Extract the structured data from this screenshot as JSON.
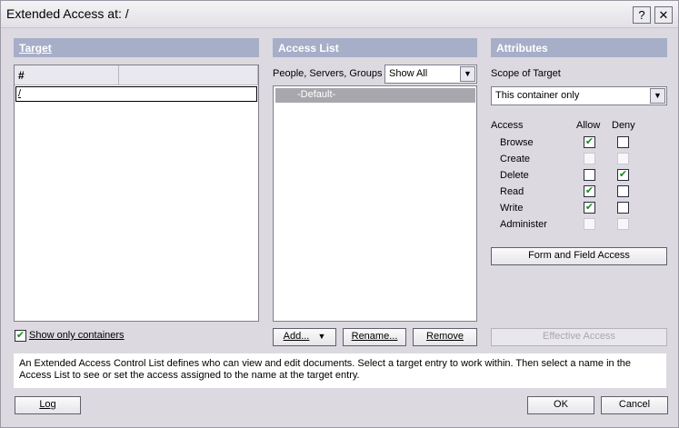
{
  "window": {
    "title": "Extended Access at: /",
    "help_glyph": "?",
    "close_glyph": "✕"
  },
  "target": {
    "header": "Target",
    "column_hash": "#",
    "rows": [
      "/"
    ],
    "show_only_containers_label": "Show only containers",
    "show_only_containers_checked": true
  },
  "access_list": {
    "header": "Access List",
    "filter_label": "People, Servers, Groups",
    "filter_value": "Show All",
    "entries": [
      "-Default-"
    ],
    "add_label": "Add...",
    "rename_label": "Rename...",
    "remove_label": "Remove"
  },
  "attributes": {
    "header": "Attributes",
    "scope_label": "Scope of Target",
    "scope_value": "This container only",
    "access_col": "Access",
    "allow_col": "Allow",
    "deny_col": "Deny",
    "rows": [
      {
        "label": "Browse",
        "allow": "checked",
        "deny": "unchecked"
      },
      {
        "label": "Create",
        "allow": "disabled",
        "deny": "disabled"
      },
      {
        "label": "Delete",
        "allow": "unchecked",
        "deny": "checked"
      },
      {
        "label": "Read",
        "allow": "checked",
        "deny": "unchecked"
      },
      {
        "label": "Write",
        "allow": "checked",
        "deny": "unchecked"
      },
      {
        "label": "Administer",
        "allow": "disabled",
        "deny": "disabled"
      }
    ],
    "form_field_label": "Form and Field Access",
    "effective_access_label": "Effective Access"
  },
  "info_text": "An Extended Access Control List defines who can view and edit documents.  Select a target entry to work within.  Then select a name in the Access List to see or set the access assigned to the name at the target entry.",
  "footer": {
    "log_label": "Log",
    "ok_label": "OK",
    "cancel_label": "Cancel"
  },
  "colors": {
    "panel_header": "#a7aec8",
    "dialog_bg": "#ddd9e1",
    "selection": "#a8a7ad",
    "check": "#1a8a1a"
  }
}
